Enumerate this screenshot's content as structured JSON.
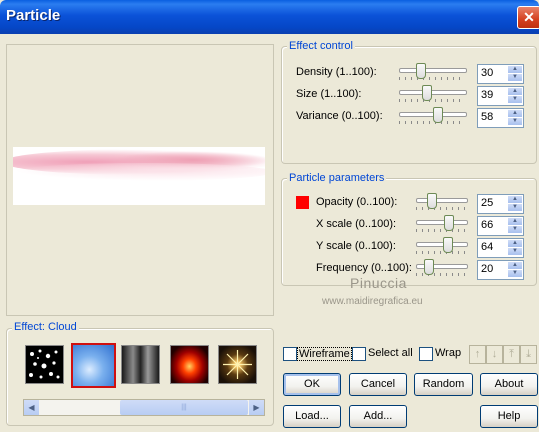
{
  "window": {
    "title": "Particle",
    "close_glyph": "✕"
  },
  "effect_control": {
    "legend": "Effect control",
    "rows": [
      {
        "label": "Density (1..100):",
        "value": "30",
        "level": 0.3
      },
      {
        "label": "Size (1..100):",
        "value": "39",
        "level": 0.39
      },
      {
        "label": "Variance (0..100):",
        "value": "58",
        "level": 0.58
      }
    ]
  },
  "particle_parameters": {
    "legend": "Particle parameters",
    "color": "#ff0000",
    "rows": [
      {
        "label": "Opacity (0..100):",
        "value": "25",
        "level": 0.25
      },
      {
        "label": "X scale (0..100):",
        "value": "66",
        "level": 0.66
      },
      {
        "label": "Y scale (0..100):",
        "value": "64",
        "level": 0.64
      },
      {
        "label": "Frequency (0..100):",
        "value": "20",
        "level": 0.2
      }
    ]
  },
  "watermark": {
    "name": "Pinuccia",
    "url": "www.maidiregrafica.eu"
  },
  "effects": {
    "legend": "Effect: Cloud",
    "items": [
      "stars",
      "cloud",
      "smoke",
      "fire",
      "sparkle"
    ],
    "selected_index": 1
  },
  "options": {
    "wireframe": "Wireframe",
    "select_all": "Select all",
    "wrap": "Wrap"
  },
  "buttons": {
    "ok": "OK",
    "cancel": "Cancel",
    "random": "Random",
    "about": "About",
    "load": "Load...",
    "add": "Add...",
    "help": "Help"
  },
  "scroll": {
    "left": "◀",
    "right": "▶",
    "grip": "|||"
  },
  "nav_arrows": [
    "↑",
    "↓",
    "⤒",
    "⤓"
  ]
}
